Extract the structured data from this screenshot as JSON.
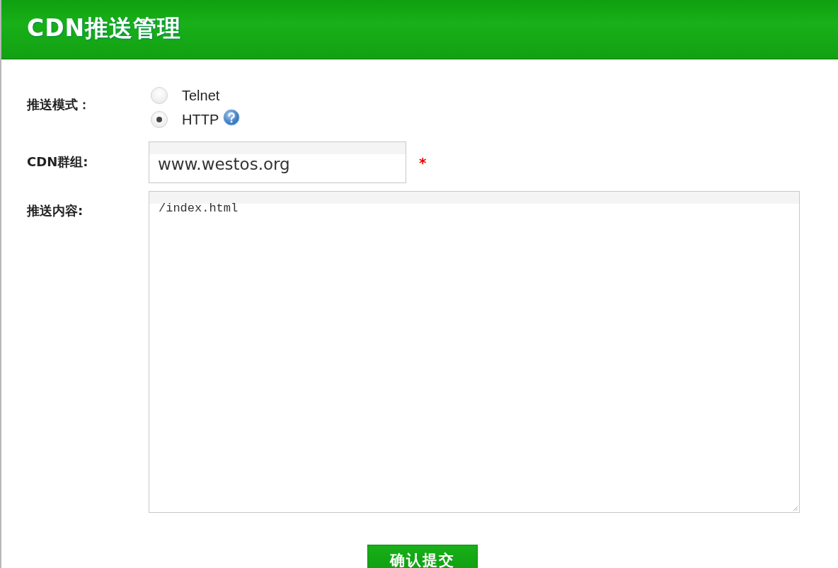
{
  "header": {
    "title": "CDN推送管理"
  },
  "form": {
    "push_mode": {
      "label": "推送模式：",
      "options": [
        {
          "label": "Telnet",
          "selected": false,
          "help": false
        },
        {
          "label": "HTTP",
          "selected": true,
          "help": true
        }
      ]
    },
    "cdn_group": {
      "label": "CDN群组:",
      "value": "www.westos.org",
      "required_mark": "*"
    },
    "content": {
      "label": "推送内容:",
      "value": "/index.html"
    },
    "submit": "确认提交"
  }
}
